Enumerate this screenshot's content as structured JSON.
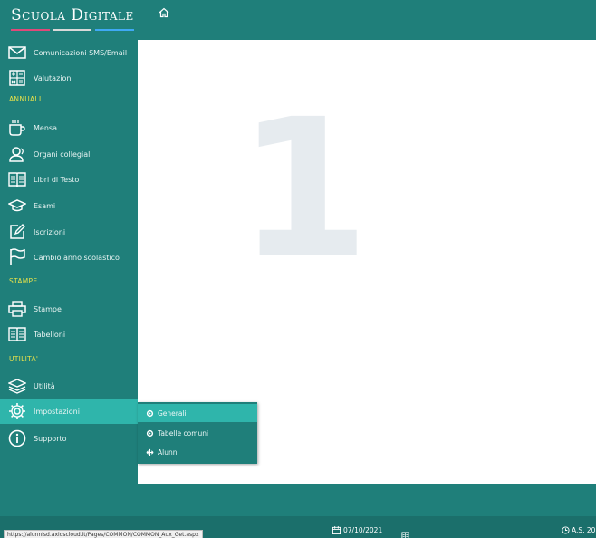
{
  "app": {
    "brand": "Scuola Digitale",
    "brand_colors": [
      "#e0497a",
      "#d9d9d9",
      "#3fa9f5"
    ]
  },
  "topbar": {
    "home_icon": "home-icon"
  },
  "sidebar": {
    "items": [
      {
        "label": "Comunicazioni SMS/Email",
        "icon": "mail-icon"
      },
      {
        "label": "Valutazioni",
        "icon": "calculator-icon"
      },
      {
        "label": "Mensa",
        "icon": "coffee-cup-icon"
      },
      {
        "label": "Organi collegiali",
        "icon": "users-icon"
      },
      {
        "label": "Libri di Testo",
        "icon": "book-icon"
      },
      {
        "label": "Esami",
        "icon": "graduation-cap-icon"
      },
      {
        "label": "Iscrizioni",
        "icon": "edit-icon"
      },
      {
        "label": "Cambio anno scolastico",
        "icon": "flag-icon"
      },
      {
        "label": "Stampe",
        "icon": "printer-icon"
      },
      {
        "label": "Tabelloni",
        "icon": "book-icon"
      },
      {
        "label": "Utilità",
        "icon": "layers-icon"
      },
      {
        "label": "Impostazioni",
        "icon": "gear-icon"
      },
      {
        "label": "Supporto",
        "icon": "info-icon"
      }
    ],
    "sections": {
      "annuali": "ANNUALI",
      "stampe": "STAMPE",
      "utilita": "UTILITA'"
    }
  },
  "content": {
    "big_number": "1",
    "big_number_color": "#e6ebef"
  },
  "submenu": {
    "items": [
      {
        "label": "Generali",
        "icon": "gear-icon"
      },
      {
        "label": "Tabelle comuni",
        "icon": "gear-icon"
      },
      {
        "label": "Alunni",
        "icon": "move-icon"
      }
    ]
  },
  "footer": {
    "date": "07/10/2021",
    "anno": "A.S. 20",
    "status_url": "https://alunnisd.axioscloud.it/Pages/COMMON/COMMON_Aux_Get.aspx"
  },
  "colors": {
    "teal": "#1f7f7a",
    "active": "#2fb5ab",
    "section": "#e6e14a"
  }
}
